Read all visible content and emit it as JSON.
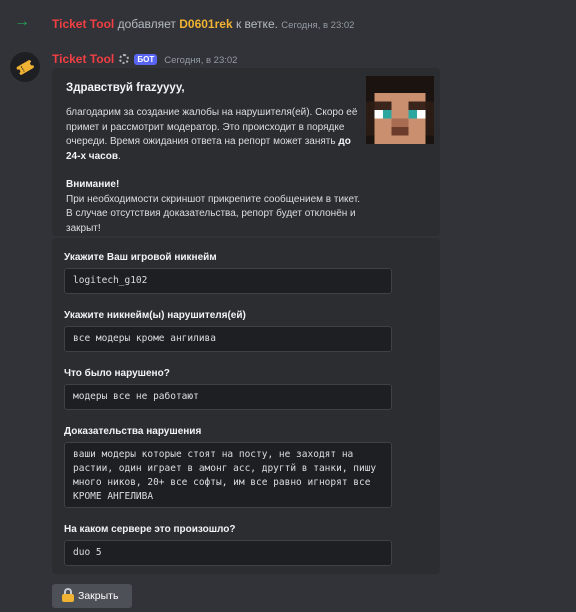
{
  "system_message": {
    "author": "Ticket Tool",
    "text_mid": " добавляет ",
    "target": "D0601rek",
    "text_end": " к ветке.",
    "timestamp": "Сегодня, в 23:02"
  },
  "message": {
    "author": "Ticket Tool",
    "badge": "БОТ",
    "timestamp": "Сегодня, в 23:02"
  },
  "embed": {
    "title": "Здравствуй frazyyyy,",
    "para1": "благодарим за создание жалобы на нарушителя(ей). Скоро её примет и рассмотрит модератор. Это происходит в порядке очереди. Время ожидания ответа на репорт может занять ",
    "para1_bold": "до 24-х часов",
    "para1_end": ".",
    "warning_title": "Внимание!",
    "warning_text": "При необходимости скриншот прикрепите сообщением в тикет. В случае отсутствия доказательства, репорт будет отклонён и закрыт!"
  },
  "form": {
    "fields": [
      {
        "label": "Укажите Ваш игровой никнейм",
        "value": "logitech_g102"
      },
      {
        "label": "Укажите никнейм(ы) нарушителя(ей)",
        "value": "все модеры кроме ангилива"
      },
      {
        "label": "Что было нарушено?",
        "value": "модеры все не работают"
      },
      {
        "label": "Доказательства нарушения",
        "value": "ваши модеры которые стоят на посту, не заходят на растии, один играет в амонг асс, другтй в танки, пишу много ников, 20+ все софты, им все равно игнорят все КРОМЕ АНГЕЛИВА"
      },
      {
        "label": "На каком сервере это произошло?",
        "value": "duo 5"
      }
    ]
  },
  "close_button": {
    "label": "Закрыть"
  },
  "icons": {
    "arrow": "join-arrow-icon",
    "lock": "lock-icon",
    "gear": "gear-icon",
    "avatar": "ticket-icon"
  }
}
